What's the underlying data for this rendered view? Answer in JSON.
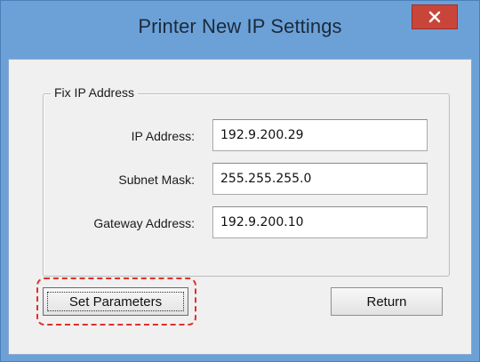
{
  "window": {
    "title": "Printer New IP Settings",
    "close_icon": "close-icon",
    "accent_color": "#6ca1d8",
    "close_color": "#c9453a"
  },
  "group": {
    "legend": "Fix IP Address"
  },
  "fields": {
    "ip_label": "IP Address:",
    "ip_value": "192.9.200.29",
    "subnet_label": "Subnet Mask:",
    "subnet_value": "255.255.255.0",
    "gateway_label": "Gateway Address:",
    "gateway_value": "192.9.200.10"
  },
  "buttons": {
    "set_parameters": "Set Parameters",
    "return": "Return"
  },
  "highlight_color": "#e0302a"
}
